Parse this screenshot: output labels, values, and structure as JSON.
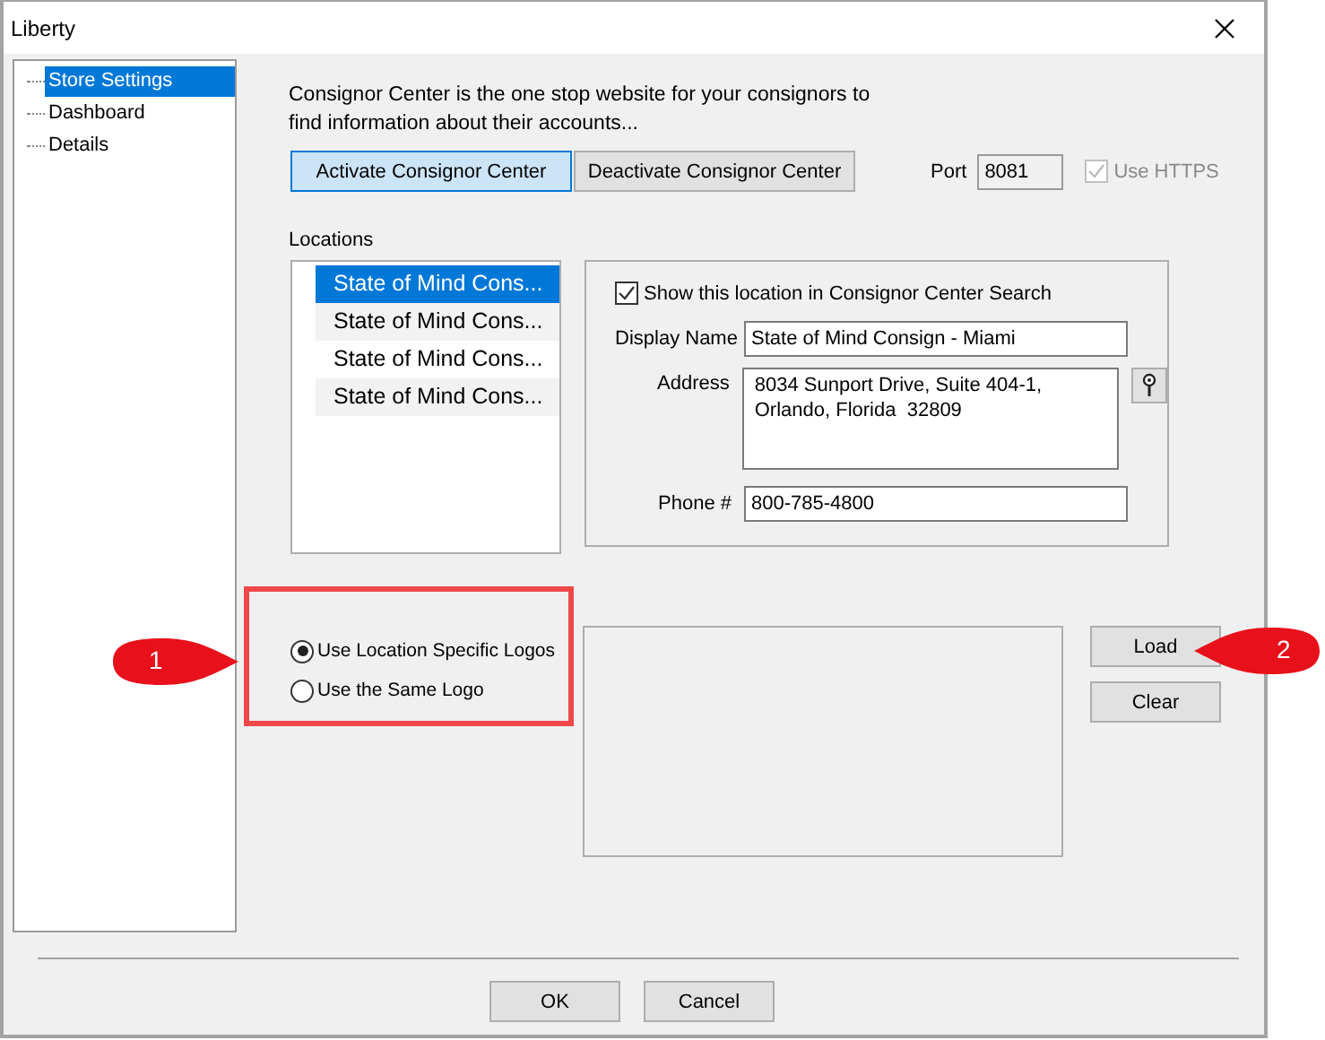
{
  "window": {
    "title": "Liberty"
  },
  "tree": [
    {
      "label": "Store Settings",
      "selected": true
    },
    {
      "label": "Dashboard",
      "selected": false
    },
    {
      "label": "Details",
      "selected": false
    }
  ],
  "description": "Consignor Center is the one stop website for your consignors to find information about their accounts...",
  "center_buttons": [
    {
      "label": "Activate Consignor Center",
      "selected": true
    },
    {
      "label": "Deactivate Consignor Center",
      "selected": false
    }
  ],
  "port": {
    "label": "Port",
    "value": "8081"
  },
  "use_https": {
    "label": "Use HTTPS",
    "checked": true,
    "disabled": true
  },
  "locations": {
    "label": "Locations",
    "items": [
      {
        "label": "State of Mind Cons...",
        "selected": true
      },
      {
        "label": "State of Mind Cons...",
        "selected": false
      },
      {
        "label": "State of Mind Cons...",
        "selected": false
      },
      {
        "label": "State of Mind Cons...",
        "selected": false
      }
    ]
  },
  "details": {
    "show_in_search": {
      "label": "Show this location in Consignor Center Search",
      "checked": true
    },
    "display_name": {
      "label": "Display Name",
      "value": "State of Mind Consign - Miami"
    },
    "address": {
      "label": "Address",
      "value": "8034 Sunport Drive, Suite 404-1,\nOrlando, Florida  32809"
    },
    "phone": {
      "label": "Phone #",
      "value": "800-785-4800"
    }
  },
  "logo_options": [
    {
      "label": "Use Location Specific Logos",
      "selected": true
    },
    {
      "label": "Use the Same Logo",
      "selected": false
    }
  ],
  "logo_buttons": [
    "Load",
    "Clear"
  ],
  "callouts": [
    "1",
    "2"
  ],
  "footer_buttons": [
    "OK",
    "Cancel"
  ]
}
